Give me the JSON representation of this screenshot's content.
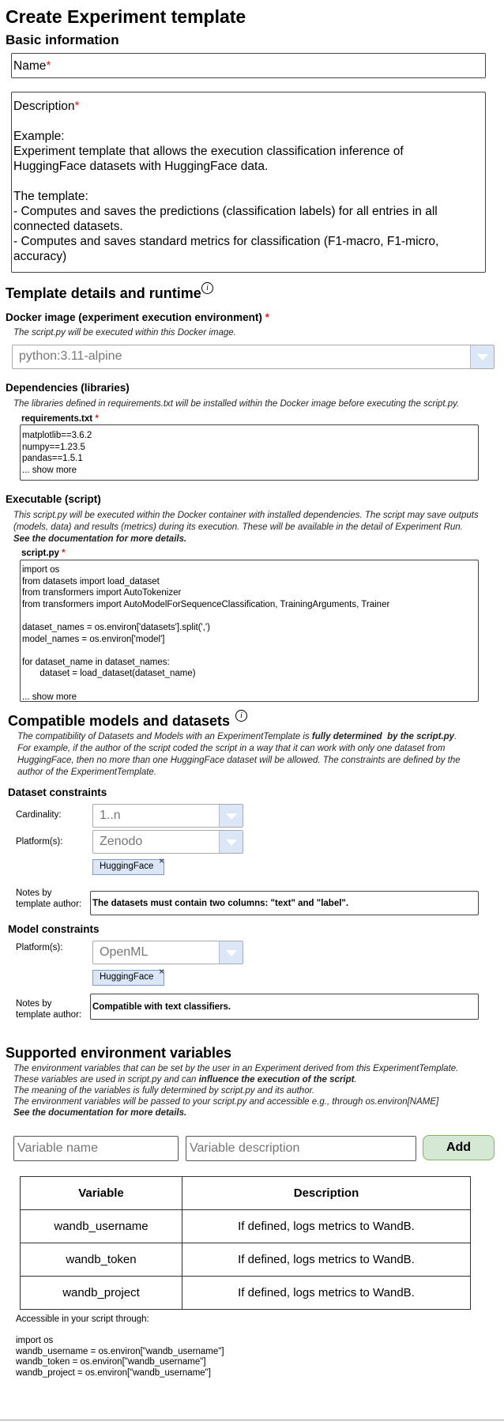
{
  "page_title": "Create Experiment template",
  "basic": {
    "heading": "Basic information",
    "name_label": "Name",
    "required_mark": "*",
    "description_label": "Description",
    "description_body": "Example:\nExperiment template that allows the execution classification inference of\nHuggingFace datasets with HuggingFace data.\n\nThe template:\n- Computes and saves the predictions (classification labels) for all entries in all\nconnected datasets.\n- Computes and saves standard metrics for classification (F1-macro, F1-micro,\naccuracy)"
  },
  "template": {
    "heading": "Template details and runtime",
    "info_glyph": "i",
    "docker_label": "Docker image (experiment execution environment)",
    "docker_hint": "The script.py will be executed within this Docker image.",
    "docker_value": "python:3.11-alpine",
    "deps_label": "Dependencies (libraries)",
    "deps_hint": "The libraries defined in requirements.txt will be installed within the Docker image before executing the script.py.",
    "req_file_label": "requirements.txt",
    "req_content": "matplotlib==3.6.2\nnumpy==1.23.5\npandas==1.5.1\n... show more",
    "exec_label": "Executable (script)",
    "exec_hint": "This script.py will be executed within the Docker container with installed dependencies. The script may save outputs\n(models, data) and results (metrics) during its execution. These will be available in the detail of Experiment Run.",
    "exec_doc": "See the documentation for more details.",
    "script_file_label": "script.py",
    "script_content": "import os\nfrom datasets import load_dataset\nfrom transformers import AutoTokenizer\nfrom transformers import AutoModelForSequenceClassification, TrainingArguments, Trainer\n\ndataset_names = os.environ['datasets'].split(',')\nmodel_names = os.environ['model']\n\nfor dataset_name in dataset_names:\n       dataset = load_dataset(dataset_name)\n\n... show more"
  },
  "compat": {
    "heading": "Compatible models and datasets",
    "hint_1": "The compatibility of Datasets and Models with an ExperimentTemplate is ",
    "hint_bold": "fully determined  by the script.py",
    "hint_2": ".\nFor example, if the author of the script coded the script in a way that it can work with only one dataset from\nHuggingFace, then no more than one HuggingFace dataset will be allowed. The constraints are defined by the\nauthor of the ExperimentTemplate.",
    "dataset_heading": "Dataset constraints",
    "cardinality_label": "Cardinality:",
    "cardinality_value": "1..n",
    "platforms_label": "Platform(s):",
    "dataset_platform_value": "Zenodo",
    "dataset_tag": "HuggingFace",
    "tag_remove": "×",
    "notes_label": "Notes by\ntemplate author:",
    "dataset_notes": "The datasets must contain two columns: \"text\" and \"label\".",
    "model_heading": "Model constraints",
    "model_platform_value": "OpenML",
    "model_tag": "HuggingFace",
    "model_notes": "Compatible with text classifiers."
  },
  "env": {
    "heading": "Supported environment variables",
    "hint_1": "The environment variables that can be set by the user in an Experiment derived from this ExperimentTemplate.\nThese variables are used in script.py and can ",
    "hint_bold": "influence the execution of the script",
    "hint_2": ".\nThe meaning of the variables is fully determined by script.py and its author.\nThe environment variables will be passed to your script.py and accessible e.g., through os.environ[NAME]",
    "hint_doc": "See the documentation for more details.",
    "var_name_placeholder": "Variable name",
    "var_desc_placeholder": "Variable description",
    "add_label": "Add",
    "columns": [
      "Variable",
      "Description"
    ],
    "rows": [
      {
        "variable": "wandb_username",
        "description": "If defined, logs metrics to WandB."
      },
      {
        "variable": "wandb_token",
        "description": "If defined, logs metrics to WandB."
      },
      {
        "variable": "wandb_project",
        "description": "If defined, logs metrics to WandB."
      }
    ],
    "access_text": "Accessible in your script through:\n\nimport os\nwandb_username = os.environ[\"wandb_username\"]\nwandb_token = os.environ[\"wandb_username\"]\nwandb_project = os.environ[\"wandb_username\"]"
  },
  "colors": {
    "required": "#dd2222",
    "combo_arrow": "#dbe7f6",
    "tag_bg": "#dbe7f6",
    "add_button_bg": "#d5e8d4",
    "add_button_border": "#82b366"
  }
}
